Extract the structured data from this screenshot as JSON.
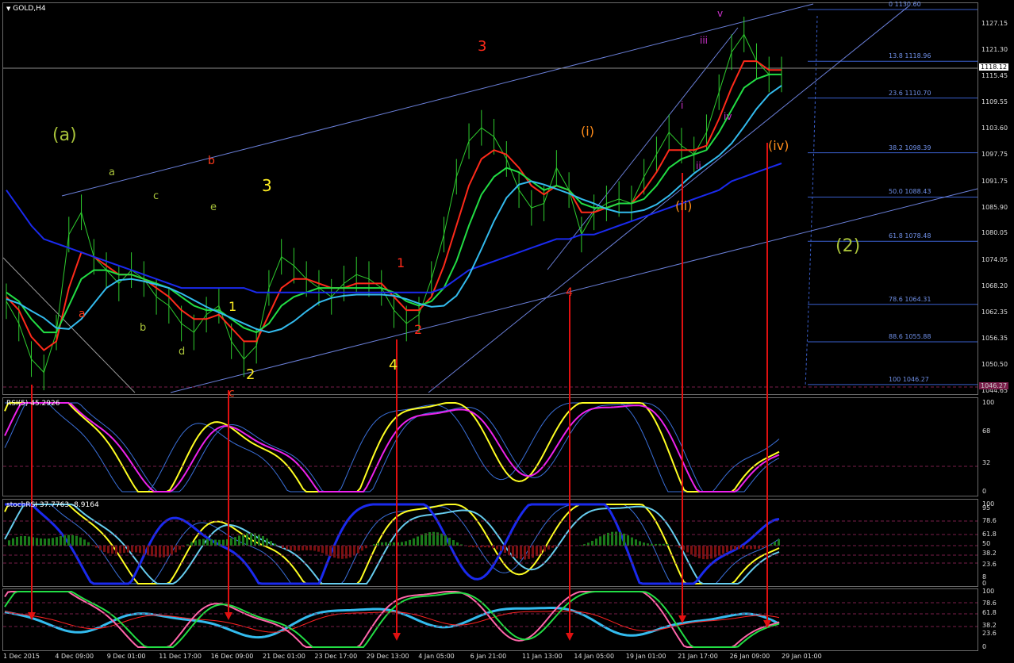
{
  "window": {
    "title": "GOLD,H4",
    "menu_icon": "triangle-down-icon"
  },
  "colors": {
    "background": "#000000",
    "price": "#2ecc2e",
    "ema_red": "#ff2a1a",
    "ema_green": "#22dd44",
    "ema_cyan": "#33bbee",
    "ma_blue": "#1a2aee",
    "channel": "#6a7fd8",
    "fib": "#3a5fcd",
    "grid_dash": "#7a1e4a",
    "arrow": "#e01010",
    "rsi_yellow": "#ffff22",
    "rsi_magenta": "#ee22ee"
  },
  "price_axis": {
    "ticks": [
      "1127.15",
      "1121.30",
      "1115.45",
      "1109.55",
      "1103.60",
      "1097.75",
      "1091.75",
      "1085.90",
      "1080.05",
      "1074.05",
      "1068.20",
      "1062.35",
      "1056.35",
      "1050.50",
      "1044.65"
    ],
    "current_price": "1118.12",
    "low_marker": "1046.27"
  },
  "fib_levels": [
    {
      "label": "0 1130.60"
    },
    {
      "label": "13.8 1118.96"
    },
    {
      "label": "23.6 1110.70"
    },
    {
      "label": "38.2 1098.39"
    },
    {
      "label": "50.0 1088.43"
    },
    {
      "label": "61.8 1078.48"
    },
    {
      "label": "78.6 1064.31"
    },
    {
      "label": "88.6 1055.88"
    },
    {
      "label": "100 1046.27"
    }
  ],
  "wave_labels": [
    {
      "text": "(a)",
      "color": "#a8c23a"
    },
    {
      "text": "a",
      "color": "#a8c23a"
    },
    {
      "text": "b",
      "color": "#ff3a1a"
    },
    {
      "text": "c",
      "color": "#a8c23a"
    },
    {
      "text": "e",
      "color": "#a8c23a"
    },
    {
      "text": "3",
      "color": "#ffee22"
    },
    {
      "text": "a",
      "color": "#ff3a1a"
    },
    {
      "text": "b",
      "color": "#a8c23a"
    },
    {
      "text": "d",
      "color": "#a8c23a"
    },
    {
      "text": "1",
      "color": "#ffee22"
    },
    {
      "text": "2",
      "color": "#ffee22"
    },
    {
      "text": "c",
      "color": "#ff3a1a"
    },
    {
      "text": "3",
      "color": "#ff2a1a"
    },
    {
      "text": "1",
      "color": "#ff2a1a"
    },
    {
      "text": "2",
      "color": "#ff2a1a"
    },
    {
      "text": "4",
      "color": "#ffee22"
    },
    {
      "text": "(i)",
      "color": "#ff8c1a"
    },
    {
      "text": "4",
      "color": "#ff2a1a"
    },
    {
      "text": "(ii)",
      "color": "#ff8c1a"
    },
    {
      "text": "i",
      "color": "#cc33cc"
    },
    {
      "text": "ii",
      "color": "#cc33cc"
    },
    {
      "text": "iii",
      "color": "#cc33cc"
    },
    {
      "text": "iv",
      "color": "#cc33cc"
    },
    {
      "text": "v",
      "color": "#cc33cc"
    },
    {
      "text": "(iv)",
      "color": "#ff8c1a"
    },
    {
      "text": "(2)",
      "color": "#a8c23a"
    }
  ],
  "time_axis": [
    "1 Dec 2015",
    "4 Dec 09:00",
    "9 Dec 01:00",
    "11 Dec 17:00",
    "16 Dec 09:00",
    "21 Dec 01:00",
    "23 Dec 17:00",
    "29 Dec 13:00",
    "4 Jan 05:00",
    "6 Jan 21:00",
    "11 Jan 13:00",
    "14 Jan 05:00",
    "19 Jan 01:00",
    "21 Jan 17:00",
    "26 Jan 09:00",
    "29 Jan 01:00"
  ],
  "rsi_panel": {
    "title": "RSI(5) 45.2926",
    "scale": [
      "100",
      "68",
      "32",
      "0"
    ]
  },
  "stoch_panel": {
    "title": "stochRSI 37.7763 -8.9164",
    "scale": [
      "100",
      "95",
      "78.6",
      "61.8",
      "50",
      "38.2",
      "23.6",
      "8",
      "0"
    ]
  },
  "bottom_panel": {
    "scale": [
      "100",
      "78.6",
      "61.8",
      "38.2",
      "23.6",
      "0"
    ]
  },
  "chart_data": {
    "type": "line",
    "title": "GOLD,H4",
    "ylim": [
      1044.65,
      1130.6
    ],
    "series": [
      {
        "values": [
          1065,
          1060,
          1052,
          1049,
          1058,
          1080,
          1085,
          1075,
          1072,
          1069,
          1072,
          1070,
          1066,
          1064,
          1060,
          1058,
          1062,
          1064,
          1056,
          1052,
          1055,
          1068,
          1075,
          1073,
          1070,
          1068,
          1066,
          1069,
          1071,
          1070,
          1068,
          1063,
          1060,
          1062,
          1070,
          1080,
          1093,
          1101,
          1104,
          1102,
          1097,
          1090,
          1086,
          1087,
          1095,
          1090,
          1080,
          1085,
          1087,
          1088,
          1087,
          1093,
          1098,
          1103,
          1100,
          1098,
          1103,
          1112,
          1121,
          1125,
          1119,
          1116,
          1116
        ]
      },
      {
        "values": [
          1066,
          1063,
          1057,
          1054,
          1056,
          1068,
          1076,
          1075,
          1073,
          1071,
          1071,
          1070,
          1068,
          1066,
          1063,
          1061,
          1061,
          1062,
          1059,
          1056,
          1056,
          1062,
          1068,
          1070,
          1070,
          1069,
          1068,
          1068,
          1069,
          1069,
          1069,
          1066,
          1063,
          1063,
          1066,
          1073,
          1082,
          1091,
          1097,
          1099,
          1098,
          1095,
          1091,
          1089,
          1091,
          1090,
          1085,
          1085,
          1086,
          1087,
          1087,
          1090,
          1094,
          1099,
          1099,
          1099,
          1100,
          1106,
          1113,
          1119,
          1119,
          1117,
          1117
        ]
      },
      {
        "values": [
          1067,
          1065,
          1061,
          1058,
          1058,
          1064,
          1070,
          1072,
          1072,
          1071,
          1071,
          1070,
          1069,
          1068,
          1066,
          1064,
          1063,
          1063,
          1061,
          1059,
          1058,
          1060,
          1064,
          1066,
          1067,
          1068,
          1068,
          1068,
          1068,
          1068,
          1068,
          1067,
          1065,
          1064,
          1065,
          1068,
          1074,
          1082,
          1089,
          1093,
          1095,
          1094,
          1092,
          1090,
          1091,
          1090,
          1087,
          1086,
          1086,
          1087,
          1087,
          1088,
          1091,
          1095,
          1097,
          1098,
          1099,
          1103,
          1108,
          1113,
          1115,
          1116,
          1116
        ]
      },
      {
        "values": [
          1090,
          1086,
          1082,
          1079,
          1078,
          1077,
          1076,
          1075,
          1074,
          1073,
          1072,
          1071,
          1070,
          1069,
          1068,
          1068,
          1068,
          1068,
          1068,
          1068,
          1067,
          1067,
          1067,
          1067,
          1067,
          1067,
          1067,
          1067,
          1067,
          1067,
          1067,
          1067,
          1067,
          1067,
          1067,
          1068,
          1070,
          1072,
          1073,
          1074,
          1075,
          1076,
          1077,
          1078,
          1079,
          1079,
          1080,
          1080,
          1081,
          1082,
          1083,
          1084,
          1085,
          1086,
          1087,
          1088,
          1089,
          1090,
          1092,
          1093,
          1094,
          1095,
          1096
        ]
      }
    ]
  }
}
